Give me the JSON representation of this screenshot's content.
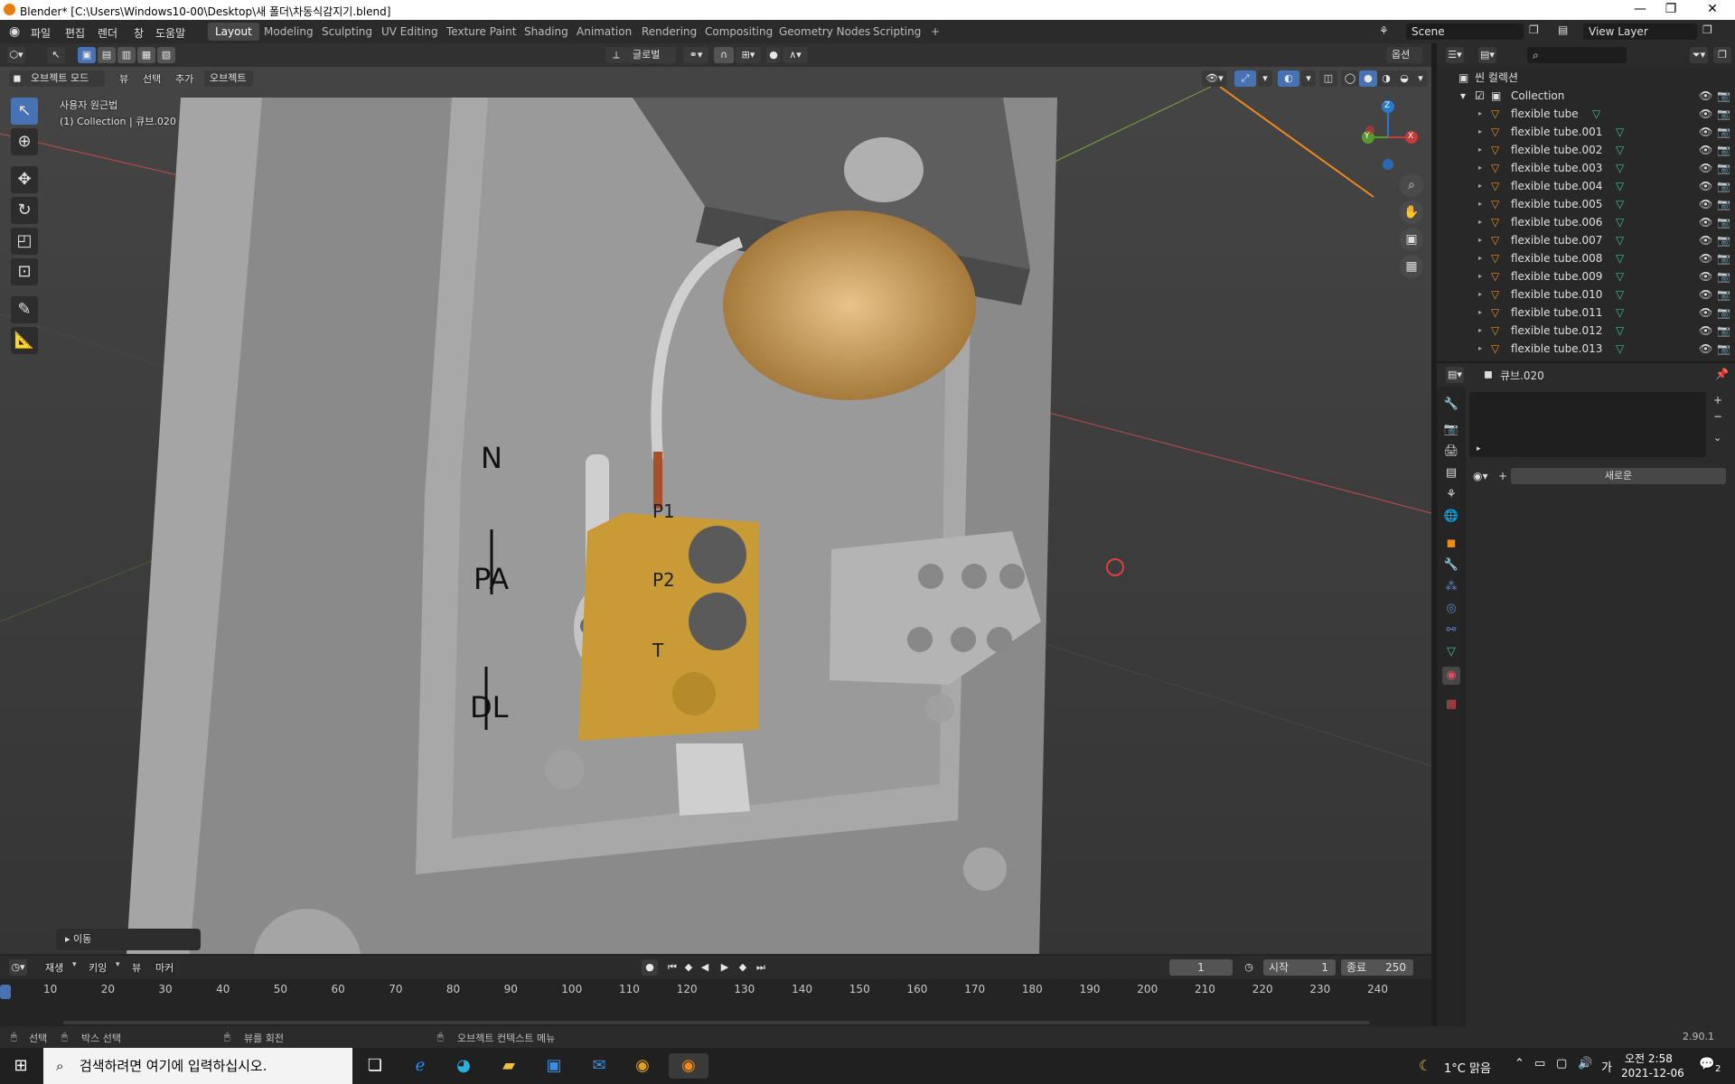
{
  "window": {
    "title": "Blender* [C:\\Users\\Windows10-00\\Desktop\\새 폴더\\차동식감지기.blend]"
  },
  "menu": [
    "파일",
    "편집",
    "렌더",
    "창",
    "도움말"
  ],
  "workspaces": [
    "Layout",
    "Modeling",
    "Sculpting",
    "UV Editing",
    "Texture Paint",
    "Shading",
    "Animation",
    "Rendering",
    "Compositing",
    "Geometry Nodes",
    "Scripting"
  ],
  "workspace_add": "+",
  "scene": {
    "name": "Scene",
    "view_layer": "View Layer"
  },
  "viewport": {
    "mode": "오브젝트 모드",
    "header_menus": [
      "뷰",
      "선택",
      "추가",
      "오브젝트"
    ],
    "orientation": "글로벌",
    "options": "옵션",
    "view_name": "사용자 원근법",
    "collection_info": "(1) Collection | 큐브.020",
    "last_op": "이동",
    "labels": {
      "n": "N",
      "pa": "PA",
      "dl": "DL",
      "p1": "P1",
      "p2": "P2",
      "t": "T"
    },
    "gizmo": {
      "z": "Z",
      "y": "Y",
      "x": "X"
    }
  },
  "outliner": {
    "root": "씬 컬렉션",
    "collection": "Collection",
    "items": [
      "flexible tube",
      "flexible tube.001",
      "flexible tube.002",
      "flexible tube.003",
      "flexible tube.004",
      "flexible tube.005",
      "flexible tube.006",
      "flexible tube.007",
      "flexible tube.008",
      "flexible tube.009",
      "flexible tube.010",
      "flexible tube.011",
      "flexible tube.012",
      "flexible tube.013"
    ]
  },
  "properties": {
    "object": "큐브.020",
    "new_button": "새로운"
  },
  "timeline": {
    "menus": [
      "재생",
      "키잉",
      "뷰",
      "마커"
    ],
    "current_frame": "1",
    "start_label": "시작",
    "start": "1",
    "end_label": "종료",
    "end": "250",
    "ticks": [
      "10",
      "20",
      "30",
      "40",
      "50",
      "60",
      "70",
      "80",
      "90",
      "100",
      "110",
      "120",
      "130",
      "140",
      "150",
      "160",
      "170",
      "180",
      "190",
      "200",
      "210",
      "220",
      "230",
      "240"
    ]
  },
  "statusbar": {
    "select": "선택",
    "box_select": "박스 선택",
    "rotate_view": "뷰를 회전",
    "context_menu": "오브젝트 컨텍스트 메뉴",
    "version": "2.90.1"
  },
  "taskbar": {
    "search_placeholder": "검색하려면 여기에 입력하십시오.",
    "weather": "1°C  맑음",
    "ime": "가",
    "time": "오전 2:58",
    "date": "2021-12-06",
    "notif": "2"
  }
}
